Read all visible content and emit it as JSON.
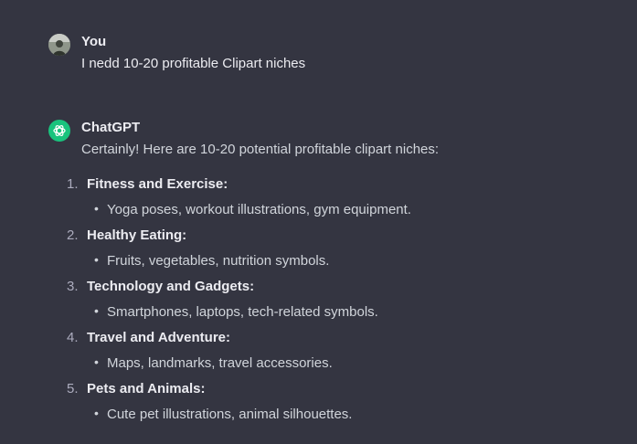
{
  "user_message": {
    "author": "You",
    "text": "I nedd 10-20 profitable Clipart niches"
  },
  "assistant_message": {
    "author": "ChatGPT",
    "intro": "Certainly! Here are 10-20 potential profitable clipart niches:",
    "niches": [
      {
        "number": "1.",
        "title": "Fitness and Exercise:",
        "detail": "Yoga poses, workout illustrations, gym equipment."
      },
      {
        "number": "2.",
        "title": "Healthy Eating:",
        "detail": "Fruits, vegetables, nutrition symbols."
      },
      {
        "number": "3.",
        "title": "Technology and Gadgets:",
        "detail": "Smartphones, laptops, tech-related symbols."
      },
      {
        "number": "4.",
        "title": "Travel and Adventure:",
        "detail": "Maps, landmarks, travel accessories."
      },
      {
        "number": "5.",
        "title": "Pets and Animals:",
        "detail": "Cute pet illustrations, animal silhouettes."
      }
    ]
  },
  "colors": {
    "background": "#343541",
    "assistant_avatar": "#19c37d",
    "text": "#ececf1"
  },
  "icons": {
    "user_avatar": "user-avatar-photo",
    "assistant_avatar": "openai-logo-icon"
  }
}
